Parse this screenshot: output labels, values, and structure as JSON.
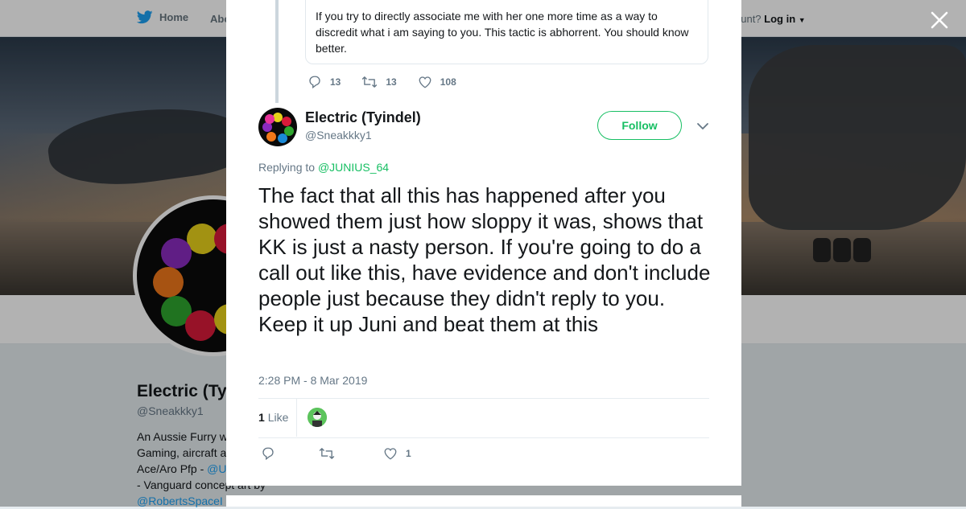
{
  "nav": {
    "home_label": "Home",
    "about_label": "Abo",
    "account_prompt": "ccount?",
    "login_label": "Log in"
  },
  "profile": {
    "name": "Electric (Ty",
    "handle": "@Sneakkky1",
    "bio_lines": [
      "An Aussie Furry w",
      "Gaming, aircraft a",
      "Ace/Aro Pfp - ",
      "- Vanguard concept art by"
    ],
    "bio_link_1": "@U",
    "bio_link_2": "@RobertsSpaceI"
  },
  "quoted_tweet": {
    "text": "If you try to directly associate me with her one more time as a way to discredit what i am saying to you. This tactic is abhorrent. You should know better.",
    "replies": "13",
    "retweets": "13",
    "likes": "108"
  },
  "tweet": {
    "display_name": "Electric (Tyindel)",
    "handle": "@Sneakkky1",
    "follow_label": "Follow",
    "replying_prefix": "Replying to ",
    "replying_to": "@JUNIUS_64",
    "text": "The fact that all this has happened after you showed them just how sloppy it was, shows that KK is just a nasty person. If you're going to do a call out like this, have evidence and don't include people just because they didn't reply to you. Keep it up Juni and beat them at this",
    "timestamp": "2:28 PM - 8 Mar 2019",
    "like_count": "1",
    "like_label": "Like",
    "action_like_count": "1"
  },
  "colors": {
    "accent": "#17bf63",
    "link": "#1da1f2",
    "text": "#14171a",
    "muted": "#657786"
  },
  "icons": {
    "nav_logo": "bird-icon",
    "close": "close-icon",
    "reply": "reply-icon",
    "retweet": "retweet-icon",
    "like": "heart-icon",
    "menu": "chevron-down-icon"
  }
}
